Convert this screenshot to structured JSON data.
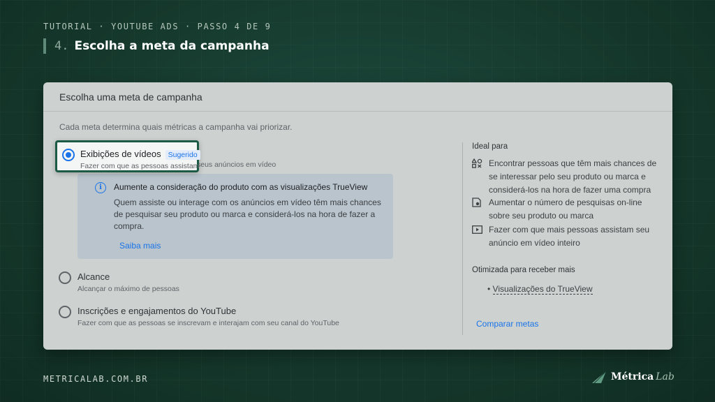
{
  "slide": {
    "eyebrow": "TUTORIAL · YOUTUBE ADS · PASSO 4 DE 9",
    "step_number": "4.",
    "step_title": "Escolha a meta da campanha"
  },
  "card": {
    "header": "Escolha uma meta de campanha",
    "subtitle": "Cada meta determina quais métricas a campanha vai priorizar.",
    "options": [
      {
        "label": "Exibições de vídeos",
        "badge": "Sugerido",
        "description": "Fazer com que as pessoas assistam",
        "description_tail": "seus anúncios em vídeo",
        "selected": true
      },
      {
        "label": "Alcance",
        "description": "Alcançar o máximo de pessoas",
        "selected": false
      },
      {
        "label": "Inscrições e engajamentos do YouTube",
        "description": "Fazer com que as pessoas se inscrevam e interajam com seu canal do YouTube",
        "selected": false
      }
    ],
    "info": {
      "icon": "info-icon",
      "title": "Aumente a consideração do produto com as visualizações TrueView",
      "body": "Quem assiste ou interage com os anúncios em vídeo têm mais chances de pesquisar seu produto ou marca e considerá-los na hora de fazer a compra.",
      "link": "Saiba mais"
    },
    "side": {
      "ideal_heading": "Ideal para",
      "benefits": [
        {
          "icon": "category-icon",
          "text": "Encontrar pessoas que têm mais chances de se interessar pelo seu produto ou marca e considerá-los na hora de fazer uma compra"
        },
        {
          "icon": "search-doc-icon",
          "text": "Aumentar o número de pesquisas on-line sobre seu produto ou marca"
        },
        {
          "icon": "video-icon",
          "text": "Fazer com que mais pessoas assistam seu anúncio em vídeo inteiro"
        }
      ],
      "optimized_heading": "Otimizada para receber mais",
      "optimized_items": [
        "Visualizações do TrueView"
      ],
      "compare_link": "Comparar metas"
    }
  },
  "footer": {
    "url": "METRICALAB.COM.BR",
    "brand_name": "Métrica",
    "brand_sub": "Lab"
  },
  "colors": {
    "background": "#15392f",
    "accent_blue": "#1a73e8",
    "highlight_border": "#1b5a45"
  }
}
